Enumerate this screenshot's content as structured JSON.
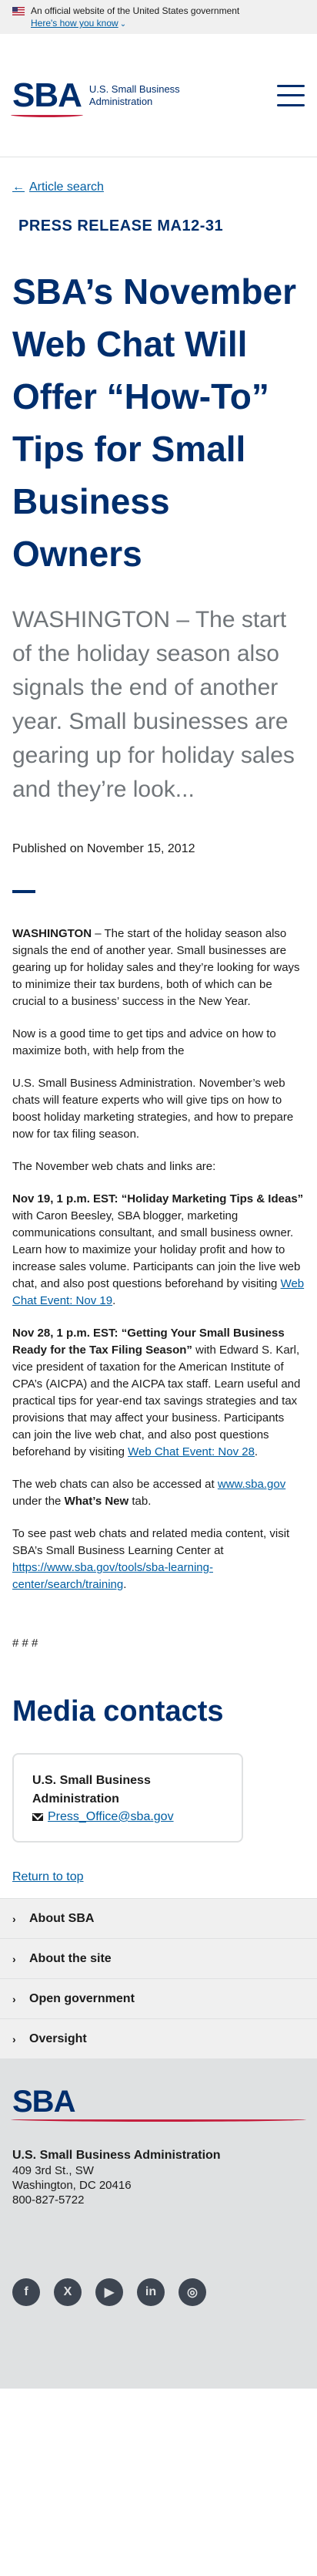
{
  "gov_banner": {
    "official_text": "An official website of the United States government",
    "how_text": "Here's how you know"
  },
  "header": {
    "logo_mark": "SBA",
    "logo_text_line1": "U.S. Small Business",
    "logo_text_line2": "Administration",
    "menu_icon": "hamburger-icon"
  },
  "article": {
    "back_link": "Article search",
    "release_number": "PRESS RELEASE MA12-31",
    "title": "SBA’s November Web Chat Will Offer “How-To” Tips for Small Business Owners",
    "summary": "WASHINGTON – The start of the holiday season also signals the end of another year.  Small businesses are gearing up for holiday sales and they’re look...",
    "published": "Published on November 15, 2012",
    "body": {
      "p1_lead": "WASHINGTON",
      "p1_rest": " – The start of the holiday season also signals the end of another year.  Small businesses are gearing up for holiday sales and they’re looking for ways to minimize their tax burdens, both of which can be crucial to a business’ success in the New Year.",
      "p2": "Now is a good time to get tips and advice on how to maximize both, with help from the",
      "p3": "U.S. Small Business Administration.  November’s web chats will feature experts who will give tips on how to boost holiday marketing strategies, and how to prepare now for tax filing season.",
      "p4": "The November web chats and links are:",
      "p5_bold": "Nov 19, 1 p.m. EST: “Holiday Marketing Tips & Ideas”",
      "p5_rest": " with Caron Beesley, SBA blogger, marketing communications consultant, and small business owner.  Learn how to maximize your holiday profit and how to increase sales volume.  Participants can join the live web chat, and also post questions beforehand by visiting ",
      "p5_link": "Web Chat Event: Nov 19",
      "p5_end": ".",
      "p6_bold": "Nov 28, 1 p.m. EST: “Getting Your Small Business Ready for the Tax Filing Season”",
      "p6_rest": " with Edward S. Karl, vice president of taxation for the American Institute of CPA’s (AICPA) and the AICPA tax staff. Learn useful and practical tips for year-end tax savings strategies and tax provisions that may affect your business.  Participants can join the live web chat, and also post questions beforehand by visiting ",
      "p6_link": "Web Chat Event: Nov 28",
      "p6_end": ".",
      "p7_start": "The web chats can also be accessed at ",
      "p7_link": "www.sba.gov",
      "p7_mid": " under the ",
      "p7_bold": "What’s New",
      "p7_end": " tab.",
      "p8_start": "To see past web chats and related media content, visit SBA’s Small Business Learning Center at ",
      "p8_link": "https://www.sba.gov/tools/sba-learning-center/search/training",
      "p8_end": "."
    },
    "hash": "# # #"
  },
  "media": {
    "heading": "Media contacts",
    "contact_name": "U.S. Small Business Administration",
    "contact_email": "Press_Office@sba.gov"
  },
  "return_top": "Return to top",
  "footer_nav": [
    "About SBA",
    "About the site",
    "Open government",
    "Oversight"
  ],
  "footer": {
    "logo_mark": "SBA",
    "org": "U.S. Small Business Administration",
    "address1": "409 3rd St., SW",
    "address2": "Washington, DC 20416",
    "phone": "800-827-5722",
    "social": [
      {
        "icon": "facebook-icon",
        "glyph": "f"
      },
      {
        "icon": "x-twitter-icon",
        "glyph": "X"
      },
      {
        "icon": "youtube-icon",
        "glyph": "▶"
      },
      {
        "icon": "linkedin-icon",
        "glyph": "in"
      },
      {
        "icon": "instagram-icon",
        "glyph": "◎"
      }
    ]
  }
}
